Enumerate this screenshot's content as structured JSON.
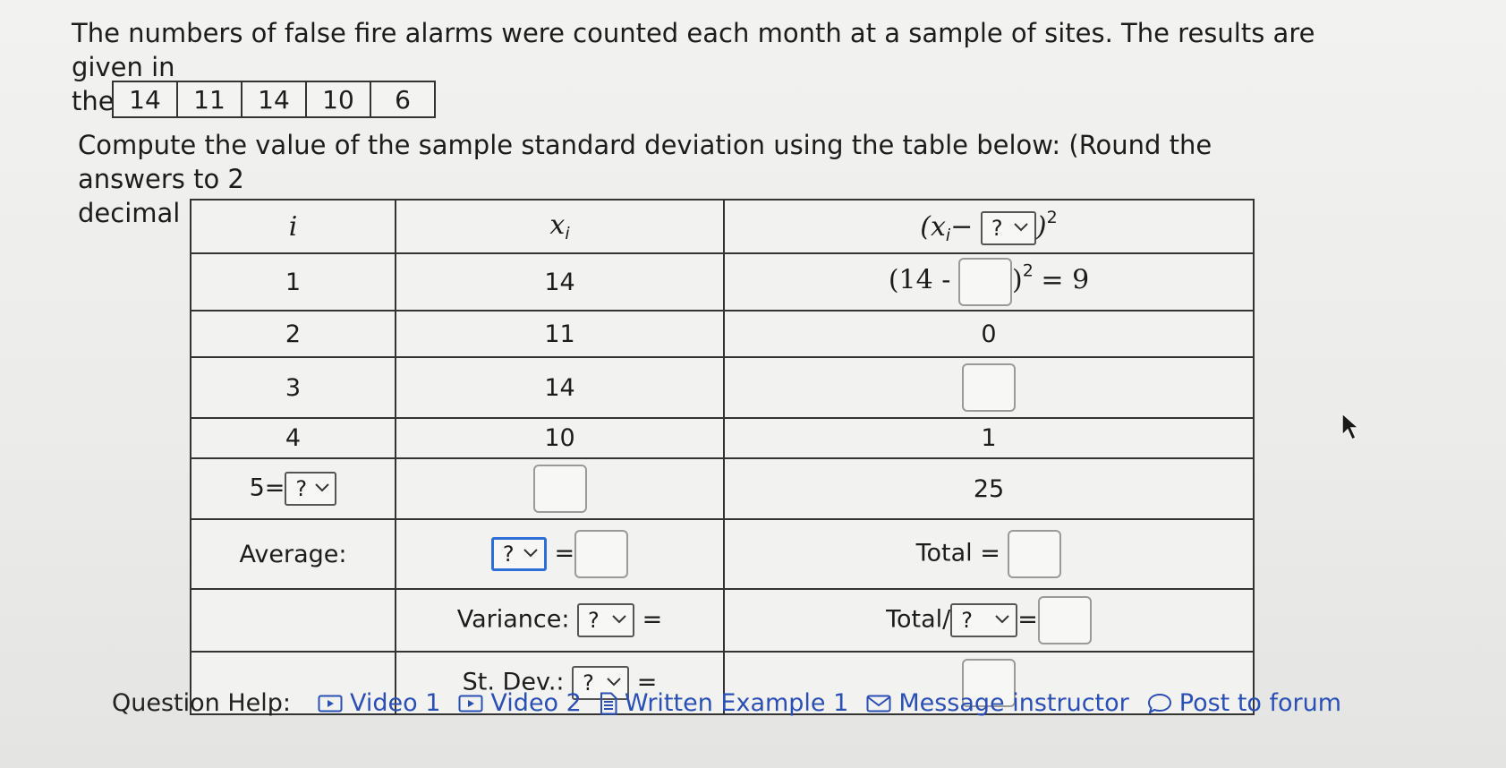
{
  "prompt": {
    "line1": "The numbers of false fire alarms were counted each month at a sample of sites. The results are given in",
    "line2": "the following table."
  },
  "data_values": [
    "14",
    "11",
    "14",
    "10",
    "6"
  ],
  "instruction": {
    "line1": "Compute the value of the sample standard deviation using the table below: (Round the answers to 2",
    "line2": "decimal places)"
  },
  "work_table": {
    "header": {
      "col_i": "i",
      "col_x": "x",
      "col_x_sub": "i",
      "col_dev_open": "(x",
      "col_dev_sub": "i",
      "col_dev_minus": "−",
      "col_dev_select": "?",
      "col_dev_close": ")",
      "col_dev_sup": "2"
    },
    "rows": [
      {
        "i": "1",
        "x": "14",
        "dev_prefix": "(14 -",
        "dev_close": ")",
        "dev_sup": "2",
        "dev_eq": "= 9"
      },
      {
        "i": "2",
        "x": "11",
        "dev": "0"
      },
      {
        "i": "3",
        "x": "14"
      },
      {
        "i": "4",
        "x": "10",
        "dev": "1"
      },
      {
        "i_prefix": "5=",
        "i_select": "?",
        "dev": "25"
      }
    ],
    "average_label": "Average:",
    "average_select": "?",
    "average_eq": "=",
    "total_label": "Total =",
    "variance_label": "Variance:",
    "variance_select": "?",
    "variance_eq": "=",
    "total_div_label": "Total/",
    "total_div_select": "?",
    "total_div_eq": "=",
    "stdev_label": "St. Dev.:",
    "stdev_select": "?",
    "stdev_eq": "="
  },
  "help": {
    "label": "Question Help:",
    "links": [
      {
        "label": "Video 1",
        "icon": "video-icon"
      },
      {
        "label": "Video 2",
        "icon": "video-icon"
      },
      {
        "label": "Written Example 1",
        "icon": "document-icon"
      },
      {
        "label": "Message instructor",
        "icon": "envelope-icon"
      },
      {
        "label": "Post to forum",
        "icon": "speech-bubble-icon"
      }
    ]
  },
  "colors": {
    "link": "#2a4fb5",
    "focus_border": "#2d6fd6",
    "text": "#1c1c1c"
  }
}
